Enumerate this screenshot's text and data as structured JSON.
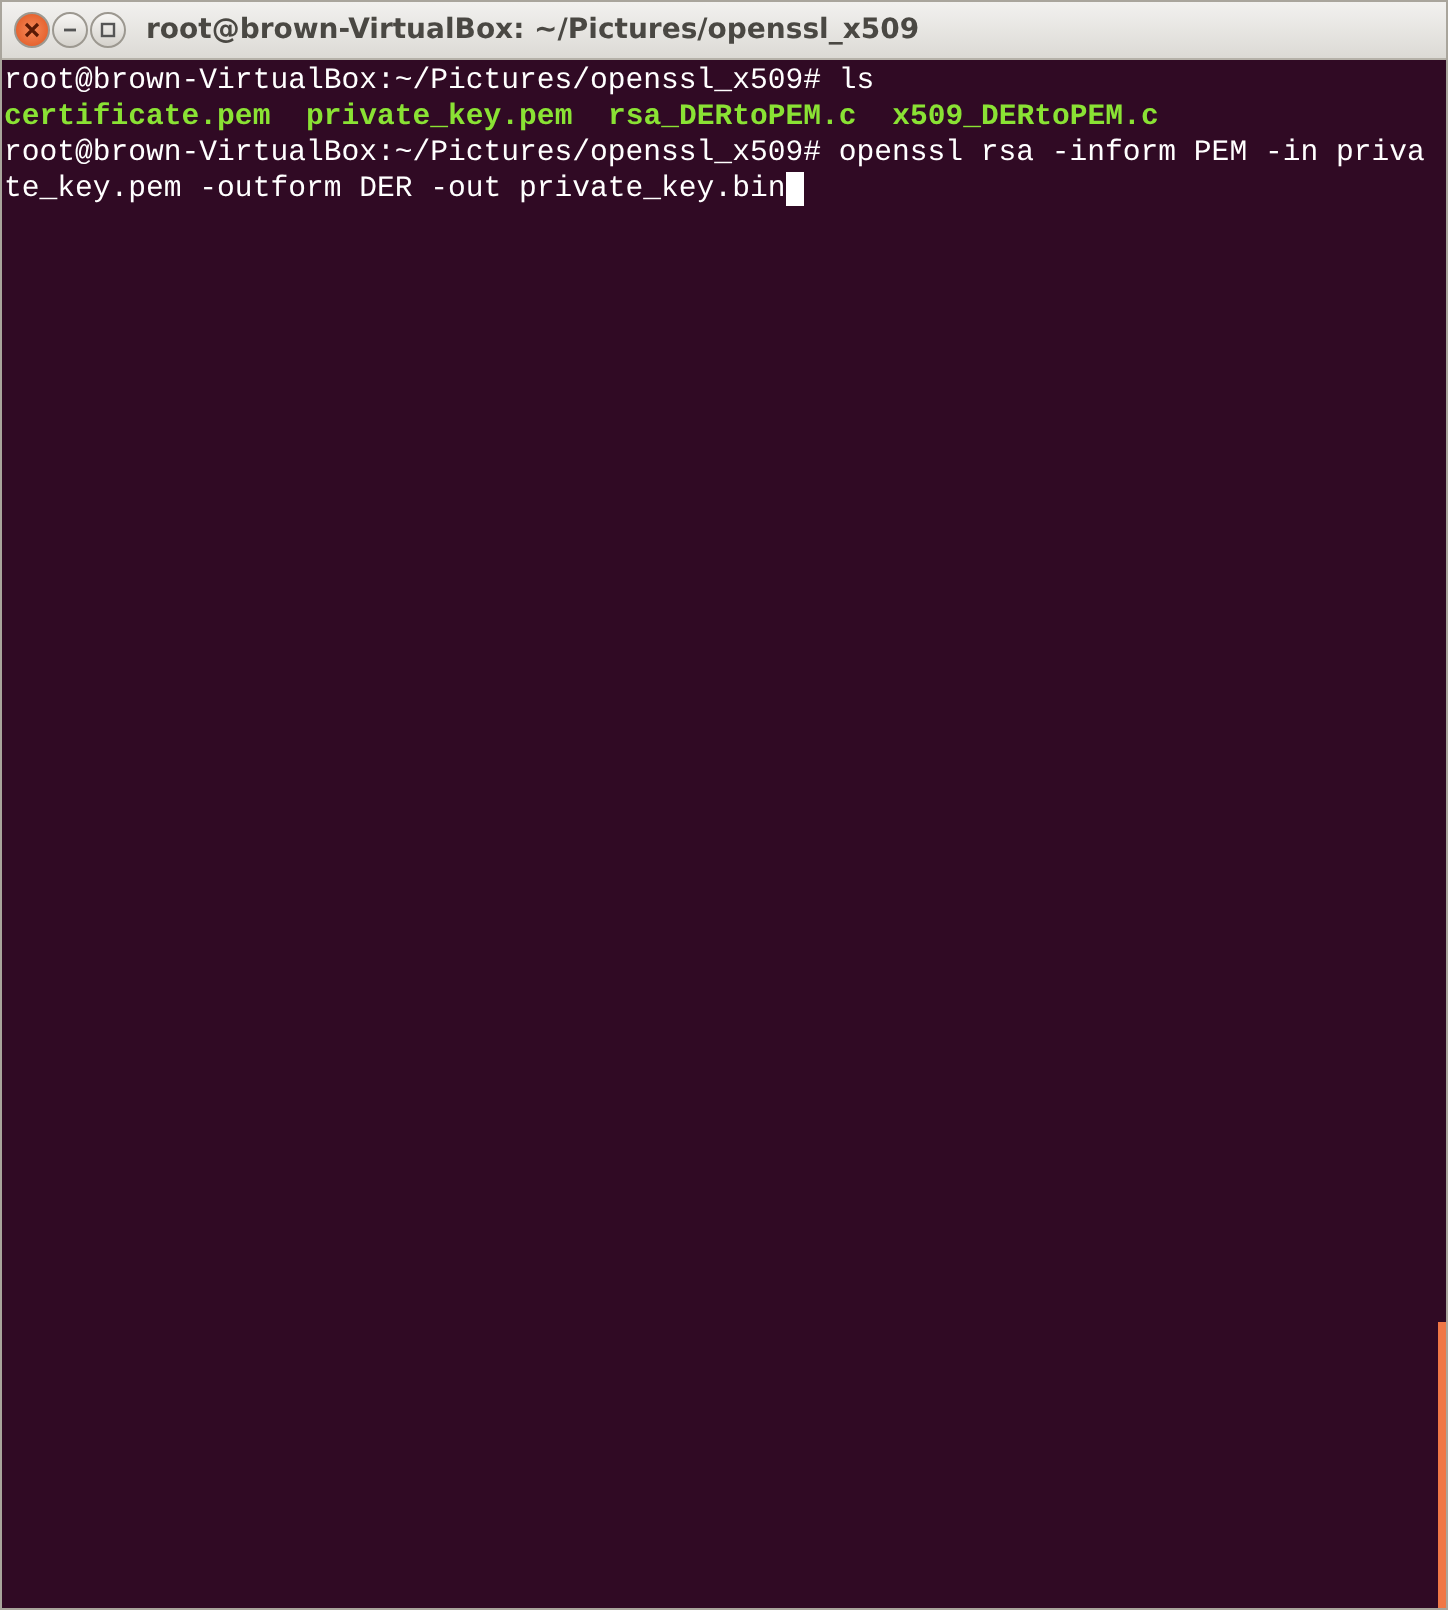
{
  "window": {
    "title": "root@brown-VirtualBox: ~/Pictures/openssl_x509"
  },
  "terminal": {
    "lines": [
      {
        "kind": "text",
        "text": "root@brown-VirtualBox:~/Pictures/openssl_x509# ls",
        "cursor": false
      },
      {
        "kind": "files",
        "files": [
          "certificate.pem",
          "private_key.pem",
          "rsa_DERtoPEM.c",
          "x509_DERtoPEM.c"
        ]
      },
      {
        "kind": "text",
        "text": "root@brown-VirtualBox:~/Pictures/openssl_x509# openssl rsa -inform PEM -in priva",
        "cursor": false
      },
      {
        "kind": "text",
        "text": "te_key.pem -outform DER -out private_key.bin",
        "cursor": true
      }
    ]
  }
}
